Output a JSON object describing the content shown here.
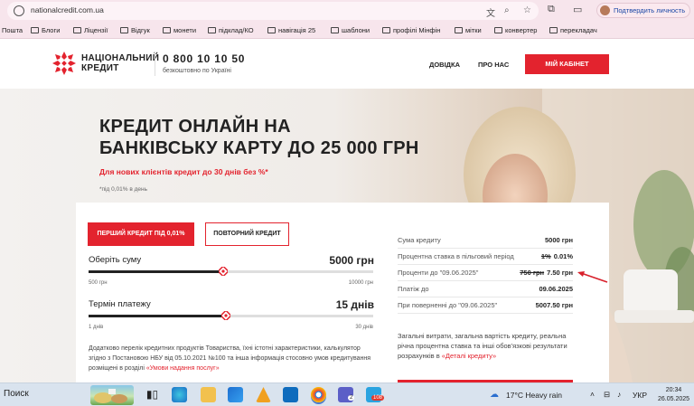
{
  "browser": {
    "url": "nationalcredit.com.ua",
    "profile_label": "Подтвердить личность"
  },
  "bookmarks": [
    {
      "label": "Пошта",
      "folder": false
    },
    {
      "label": "Блоги",
      "folder": true
    },
    {
      "label": "Ліцензії",
      "folder": true
    },
    {
      "label": "Відгук",
      "folder": true
    },
    {
      "label": "монети",
      "folder": true
    },
    {
      "label": "підклад/КО",
      "folder": true
    },
    {
      "label": "навігація 25",
      "folder": true
    },
    {
      "label": "шаблони",
      "folder": true
    },
    {
      "label": "профілі Мінфін",
      "folder": true
    },
    {
      "label": "мітки",
      "folder": true
    },
    {
      "label": "конвертер",
      "folder": true
    },
    {
      "label": "перекладач",
      "folder": true
    }
  ],
  "header": {
    "logo_line1": "НАЦІОНАЛЬНИЙ",
    "logo_line2": "КРЕДИТ",
    "phone": "0 800 10 10 50",
    "phone_note": "безкоштовно по Україні",
    "nav": [
      "ДОВІДКА",
      "ПРО НАС"
    ],
    "cabinet_button": "МІЙ КАБІНЕТ"
  },
  "hero": {
    "title_line1": "КРЕДИТ ОНЛАЙН НА",
    "title_line2": "БАНКІВСЬКУ КАРТУ ДО 25 000 ГРН",
    "subtitle": "Для нових клієнтів кредит до 30 днів без %*",
    "footnote": "*під 0,01% в день"
  },
  "calculator": {
    "tab_first": "ПЕРШИЙ КРЕДИТ ПІД 0,01%",
    "tab_repeat": "ПОВТОРНИЙ КРЕДИТ",
    "amount": {
      "label": "Оберіть суму",
      "value": "5000 грн",
      "min_label": "500 грн",
      "max_label": "10000 грн",
      "min": 500,
      "max": 10000,
      "current": 5000
    },
    "term": {
      "label": "Термін платежу",
      "value": "15 днів",
      "min_label": "1 днів",
      "max_label": "30 днів",
      "min": 1,
      "max": 30,
      "current": 15
    },
    "extra_info_text": "Додатково перелік кредитних продуктів Товариства, їхні істотні характеристики, калькулятор згідно з Постановою НБУ від 05.10.2021 №100 та інша інформація стосовно умов кредитування розміщені в розділі ",
    "extra_info_link": "«Умови надання послуг»"
  },
  "summary": {
    "rows": [
      {
        "key": "Сума кредиту",
        "old": "",
        "value": "5000 грн"
      },
      {
        "key": "Процентна ставка в пільговий період",
        "old": "1%",
        "value": "0.01%"
      },
      {
        "key": "Проценти до \"09.06.2025\"",
        "old": "750 грн",
        "value": "7.50 грн"
      },
      {
        "key": "Платіж до",
        "old": "",
        "value": "09.06.2025"
      },
      {
        "key": "При поверненні до \"09.06.2025\"",
        "old": "",
        "value": "5007.50 грн"
      }
    ],
    "note_text": "Загальні витрати, загальна вартість кредиту, реальна річна процентна ставка та інші обов'язкові результати розрахунків в ",
    "note_link": "«Деталі кредиту»"
  },
  "taskbar": {
    "search_label": "Поиск",
    "weather": "17°C  Heavy rain",
    "language": "УКР",
    "time": "20:34",
    "date": "26.05.2025",
    "badge_teams": "2",
    "badge_telegram": "108"
  },
  "colors": {
    "brand_red": "#e3232e",
    "browser_chrome": "#f7e5ec",
    "taskbar": "#d9e3ee"
  }
}
